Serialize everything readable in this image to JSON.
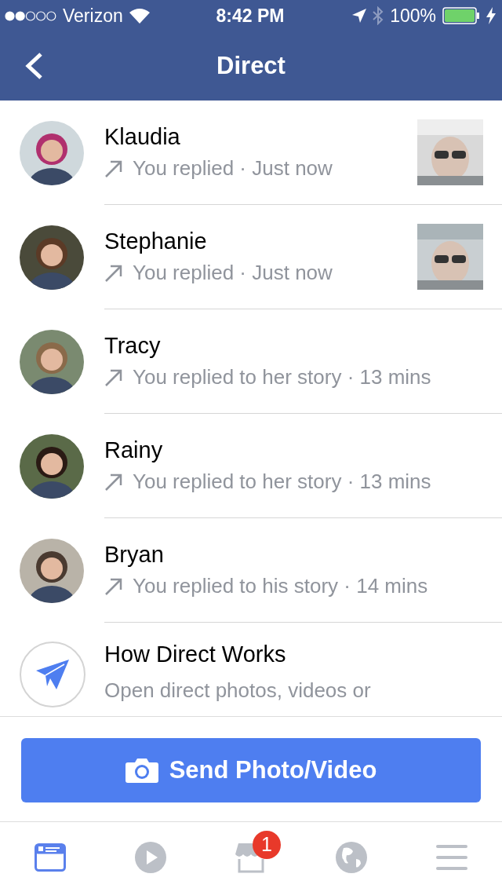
{
  "status_bar": {
    "carrier": "Verizon",
    "time": "8:42 PM",
    "battery": "100%"
  },
  "nav": {
    "title": "Direct"
  },
  "conversations": [
    {
      "name": "Klaudia",
      "subtitle": "You replied · Just now"
    },
    {
      "name": "Stephanie",
      "subtitle": "You replied · Just now"
    },
    {
      "name": "Tracy",
      "subtitle": "You replied to her story · 13 mins"
    },
    {
      "name": "Rainy",
      "subtitle": "You replied to her story · 13 mins"
    },
    {
      "name": "Bryan",
      "subtitle": "You replied to his story · 14 mins"
    }
  ],
  "info": {
    "title": "How Direct Works",
    "text": "Open direct photos, videos or"
  },
  "send_button": {
    "label": "Send Photo/Video"
  },
  "tabs": [
    {
      "kind": "feed",
      "selected": true
    },
    {
      "kind": "video",
      "selected": false
    },
    {
      "kind": "marketplace",
      "selected": false,
      "badge": "1"
    },
    {
      "kind": "globe",
      "selected": false
    },
    {
      "kind": "menu",
      "selected": false
    }
  ]
}
